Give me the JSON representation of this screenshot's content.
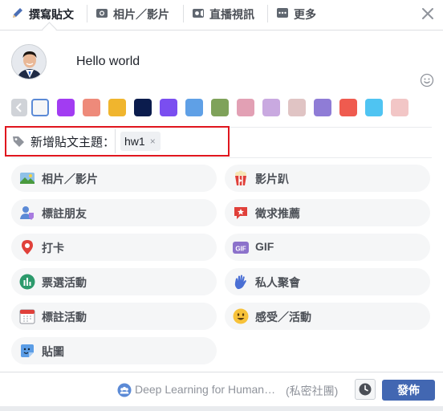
{
  "tabs": [
    {
      "label": "撰寫貼文",
      "icon": "pencil-icon"
    },
    {
      "label": "相片／影片",
      "icon": "camera-icon"
    },
    {
      "label": "直播視訊",
      "icon": "video-camera-icon"
    },
    {
      "label": "更多",
      "icon": "more-icon"
    }
  ],
  "composer": {
    "text": "Hello world"
  },
  "backgrounds": {
    "swatches": [
      "#f5f6f7",
      "#a23cf2",
      "#ee8a7a",
      "#f0b52e",
      "#0b1c4d",
      "#7a4ef0",
      "#5fa0e6",
      "#7fa25a",
      "#e2a0b4",
      "#c9a9e0",
      "#e0c4c4",
      "#8f7cd6",
      "#ef5b4f",
      "#4fc4f2",
      "#f2c6c6"
    ]
  },
  "topic": {
    "label": "新增貼文主題：",
    "tag": "hw1",
    "remove": "×"
  },
  "actions": [
    {
      "label": "相片／影片",
      "icon": "photo-icon"
    },
    {
      "label": "影片趴",
      "icon": "popcorn-icon"
    },
    {
      "label": "標註朋友",
      "icon": "tag-friend-icon"
    },
    {
      "label": "徵求推薦",
      "icon": "recommend-icon"
    },
    {
      "label": "打卡",
      "icon": "location-pin-icon"
    },
    {
      "label": "GIF",
      "icon": "gif-icon"
    },
    {
      "label": "票選活動",
      "icon": "poll-icon"
    },
    {
      "label": "私人聚會",
      "icon": "hand-wave-icon"
    },
    {
      "label": "標註活動",
      "icon": "calendar-icon"
    },
    {
      "label": "感受／活動",
      "icon": "smiley-icon"
    },
    {
      "label": "貼圖",
      "icon": "sticker-icon"
    }
  ],
  "footer": {
    "audience": "Deep Learning for Human…",
    "privacy": "(私密社團)",
    "post_button": "發佈"
  }
}
